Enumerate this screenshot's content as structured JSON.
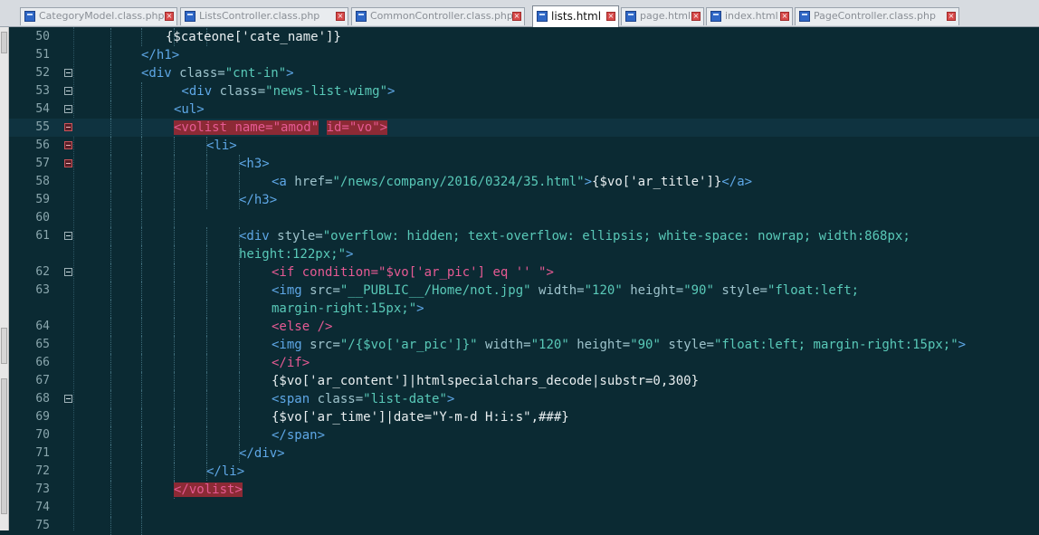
{
  "tabs": [
    {
      "label": "CategoryModel.class.php",
      "active": false
    },
    {
      "label": "ListsController.class.php",
      "active": false
    },
    {
      "label": "CommonController.class.php",
      "active": false
    },
    {
      "label": "lists.html",
      "active": true
    },
    {
      "label": "page.html",
      "active": false
    },
    {
      "label": "index.html",
      "active": false
    },
    {
      "label": "PageController.class.php",
      "active": false
    }
  ],
  "lines": [
    {
      "num": "50",
      "fold": "none",
      "segs": [
        {
          "t": "{$cateone['cate_name']}",
          "c": "txt"
        }
      ]
    },
    {
      "num": "51",
      "fold": "none",
      "segs": [
        {
          "t": "</h1>",
          "c": "tag"
        }
      ]
    },
    {
      "num": "52",
      "fold": "box",
      "segs": [
        {
          "t": "<div ",
          "c": "tag"
        },
        {
          "t": "class=",
          "c": "attr"
        },
        {
          "t": "\"cnt-in\"",
          "c": "str"
        },
        {
          "t": ">",
          "c": "tag"
        }
      ]
    },
    {
      "num": "53",
      "fold": "box",
      "segs": [
        {
          "t": " <div ",
          "c": "tag"
        },
        {
          "t": "class=",
          "c": "attr"
        },
        {
          "t": "\"news-list-wimg\"",
          "c": "str"
        },
        {
          "t": ">",
          "c": "tag"
        }
      ]
    },
    {
      "num": "54",
      "fold": "box",
      "segs": [
        {
          "t": "<ul>",
          "c": "tag"
        }
      ]
    },
    {
      "num": "55",
      "fold": "red",
      "segs": [
        {
          "t": "<volist ",
          "c": "kw hl"
        },
        {
          "t": "name=",
          "c": "kw hl"
        },
        {
          "t": "\"amod\"",
          "c": "kw hl"
        },
        {
          "t": " ",
          "c": "txt"
        },
        {
          "t": "id=",
          "c": "kw hl"
        },
        {
          "t": "\"vo\"",
          "c": "kw hl"
        },
        {
          "t": ">",
          "c": "kw hl"
        }
      ]
    },
    {
      "num": "56",
      "fold": "red",
      "segs": [
        {
          "t": "<li>",
          "c": "tag"
        }
      ]
    },
    {
      "num": "57",
      "fold": "red",
      "segs": [
        {
          "t": "<h3>",
          "c": "tag"
        }
      ]
    },
    {
      "num": "58",
      "fold": "none",
      "segs": [
        {
          "t": "<a ",
          "c": "tag"
        },
        {
          "t": "href=",
          "c": "attr"
        },
        {
          "t": "\"/news/company/2016/0324/35.html\"",
          "c": "str"
        },
        {
          "t": ">",
          "c": "tag"
        },
        {
          "t": "{$vo['ar_title']}",
          "c": "txt"
        },
        {
          "t": "</a>",
          "c": "tag"
        }
      ]
    },
    {
      "num": "59",
      "fold": "none",
      "segs": [
        {
          "t": "</h3>",
          "c": "tag"
        }
      ]
    },
    {
      "num": "60",
      "fold": "none",
      "segs": []
    },
    {
      "num": "61",
      "fold": "box",
      "segs": [
        {
          "t": "<div ",
          "c": "tag"
        },
        {
          "t": "style=",
          "c": "attr"
        },
        {
          "t": "\"overflow: hidden; text-overflow: ellipsis; white-space: nowrap; width:868px;",
          "c": "str"
        }
      ]
    },
    {
      "num": "",
      "fold": "none",
      "segs": [
        {
          "t": "height:122px;\"",
          "c": "str"
        },
        {
          "t": ">",
          "c": "tag"
        }
      ]
    },
    {
      "num": "62",
      "fold": "box",
      "segs": [
        {
          "t": "<if ",
          "c": "kw"
        },
        {
          "t": "condition=",
          "c": "kw"
        },
        {
          "t": "\"$vo['ar_pic'] eq '' \"",
          "c": "kw"
        },
        {
          "t": ">",
          "c": "kw"
        }
      ]
    },
    {
      "num": "63",
      "fold": "none",
      "segs": [
        {
          "t": "<img ",
          "c": "tag"
        },
        {
          "t": "src=",
          "c": "attr"
        },
        {
          "t": "\"__PUBLIC__/Home/not.jpg\"",
          "c": "str"
        },
        {
          "t": " width=",
          "c": "attr"
        },
        {
          "t": "\"120\"",
          "c": "str"
        },
        {
          "t": " height=",
          "c": "attr"
        },
        {
          "t": "\"90\"",
          "c": "str"
        },
        {
          "t": " style=",
          "c": "attr"
        },
        {
          "t": "\"float:left;",
          "c": "str"
        }
      ]
    },
    {
      "num": "",
      "fold": "none",
      "segs": [
        {
          "t": "margin-right:15px;\"",
          "c": "str"
        },
        {
          "t": ">",
          "c": "tag"
        }
      ]
    },
    {
      "num": "64",
      "fold": "none",
      "segs": [
        {
          "t": "<else />",
          "c": "kw"
        }
      ]
    },
    {
      "num": "65",
      "fold": "none",
      "segs": [
        {
          "t": "<img ",
          "c": "tag"
        },
        {
          "t": "src=",
          "c": "attr"
        },
        {
          "t": "\"/{$vo['ar_pic']}\"",
          "c": "str"
        },
        {
          "t": " width=",
          "c": "attr"
        },
        {
          "t": "\"120\"",
          "c": "str"
        },
        {
          "t": " height=",
          "c": "attr"
        },
        {
          "t": "\"90\"",
          "c": "str"
        },
        {
          "t": " style=",
          "c": "attr"
        },
        {
          "t": "\"float:left; margin-right:15px;\"",
          "c": "str"
        },
        {
          "t": ">",
          "c": "tag"
        }
      ]
    },
    {
      "num": "66",
      "fold": "none",
      "segs": [
        {
          "t": "</if>",
          "c": "kw"
        }
      ]
    },
    {
      "num": "67",
      "fold": "none",
      "segs": [
        {
          "t": "{$vo['ar_content']|htmlspecialchars_decode|substr=0,300}",
          "c": "txt"
        }
      ]
    },
    {
      "num": "68",
      "fold": "box",
      "segs": [
        {
          "t": "<span ",
          "c": "tag"
        },
        {
          "t": "class=",
          "c": "attr"
        },
        {
          "t": "\"list-date\"",
          "c": "str"
        },
        {
          "t": ">",
          "c": "tag"
        }
      ]
    },
    {
      "num": "69",
      "fold": "none",
      "segs": [
        {
          "t": "{$vo['ar_time']|date=\"Y-m-d H:i:s\",###}",
          "c": "txt"
        }
      ]
    },
    {
      "num": "70",
      "fold": "none",
      "segs": [
        {
          "t": "</span>",
          "c": "tag"
        }
      ]
    },
    {
      "num": "71",
      "fold": "none",
      "segs": [
        {
          "t": "</div>",
          "c": "tag"
        }
      ]
    },
    {
      "num": "72",
      "fold": "none",
      "segs": [
        {
          "t": "</li>",
          "c": "tag"
        }
      ]
    },
    {
      "num": "73",
      "fold": "none",
      "segs": [
        {
          "t": "</volist>",
          "c": "kw hl"
        }
      ]
    },
    {
      "num": "74",
      "fold": "none",
      "segs": []
    },
    {
      "num": "75",
      "fold": "none",
      "segs": []
    }
  ]
}
